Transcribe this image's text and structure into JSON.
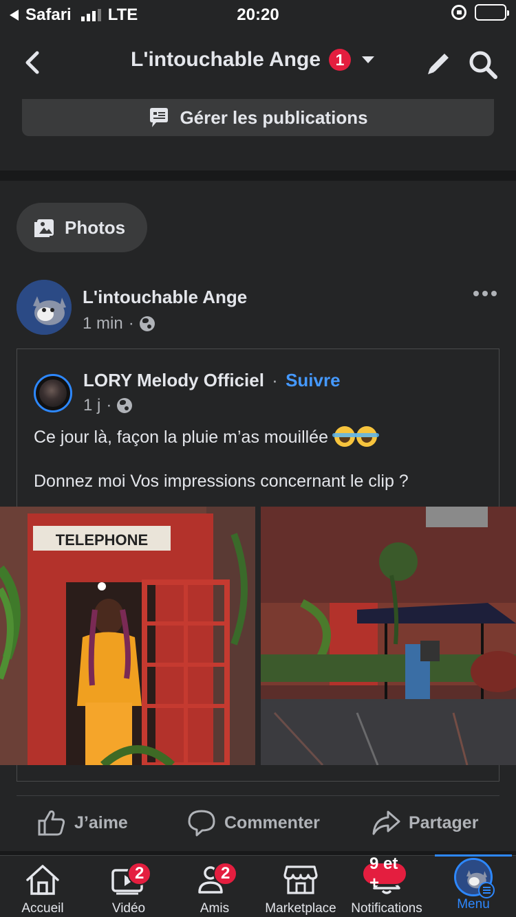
{
  "status_bar": {
    "carrier": "Safari",
    "network": "LTE",
    "time": "20:20"
  },
  "nav": {
    "title": "L'intouchable Ange",
    "badge": "1"
  },
  "manage": {
    "label": "Gérer les publications"
  },
  "photos_chip": {
    "label": "Photos"
  },
  "post": {
    "author": "L'intouchable Ange",
    "time": "1 min",
    "shared": {
      "author": "LORY Melody Officiel",
      "separator": "·",
      "follow": "Suivre",
      "time": "1 j",
      "text_line1": "Ce jour là, façon la pluie m’as mouillée",
      "text_line2": "Donnez moi Vos impressions concernant le clip ?"
    },
    "photo_sign": "TELEPHONE",
    "actions": {
      "like": "J’aime",
      "comment": "Commenter",
      "share": "Partager"
    }
  },
  "tabbar": {
    "home": {
      "label": "Accueil"
    },
    "video": {
      "label": "Vidéo",
      "badge": "2"
    },
    "friends": {
      "label": "Amis",
      "badge": "2"
    },
    "marketplace": {
      "label": "Marketplace"
    },
    "notifications": {
      "label": "Notifications",
      "badge": "9 et +"
    },
    "menu": {
      "label": "Menu"
    }
  },
  "colors": {
    "background": "#18191a",
    "surface": "#242526",
    "button": "#3a3b3c",
    "accent": "#2d88ff",
    "badge": "#e41e3f",
    "link": "#4599ff"
  }
}
